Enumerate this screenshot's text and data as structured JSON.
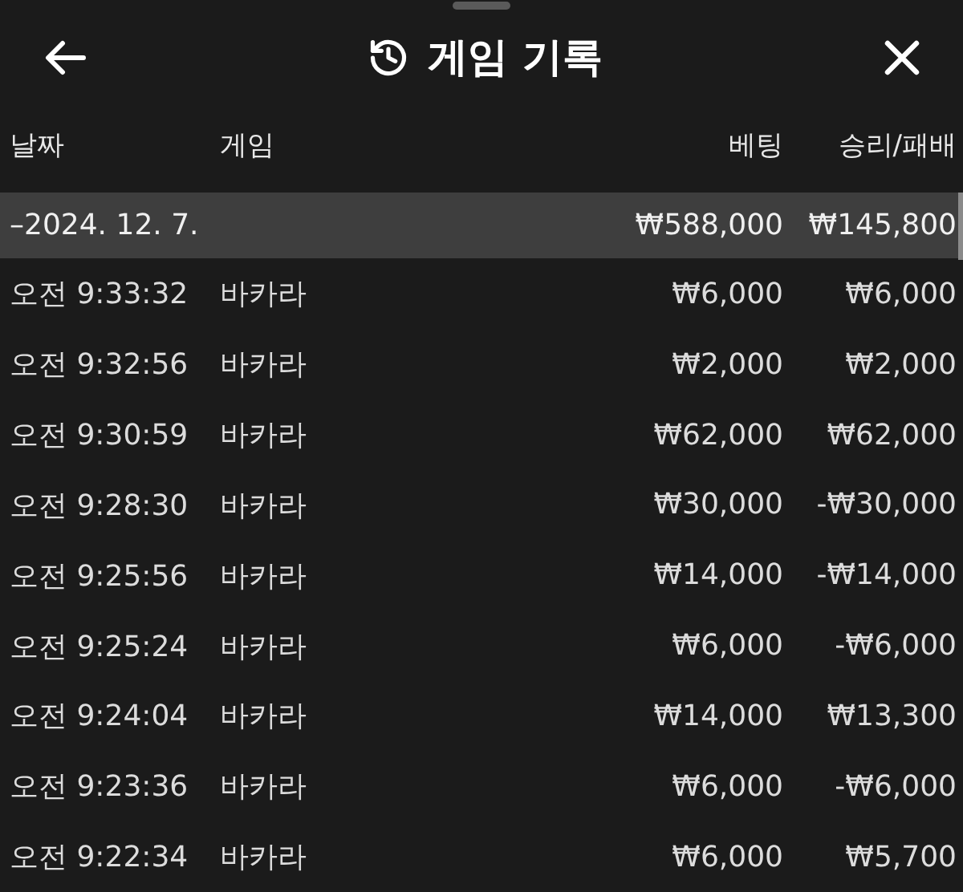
{
  "header": {
    "title": "게임 기록"
  },
  "columns": [
    "날짜",
    "게임",
    "베팅",
    "승리/패배"
  ],
  "group": {
    "date": "–2024. 12. 7.",
    "bet": "₩588,000",
    "result": "₩145,800"
  },
  "rows": [
    {
      "time": "오전 9:33:32",
      "game": "바카라",
      "bet": "₩6,000",
      "result": "₩6,000"
    },
    {
      "time": "오전 9:32:56",
      "game": "바카라",
      "bet": "₩2,000",
      "result": "₩2,000"
    },
    {
      "time": "오전 9:30:59",
      "game": "바카라",
      "bet": "₩62,000",
      "result": "₩62,000"
    },
    {
      "time": "오전 9:28:30",
      "game": "바카라",
      "bet": "₩30,000",
      "result": "-₩30,000"
    },
    {
      "time": "오전 9:25:56",
      "game": "바카라",
      "bet": "₩14,000",
      "result": "-₩14,000"
    },
    {
      "time": "오전 9:25:24",
      "game": "바카라",
      "bet": "₩6,000",
      "result": "-₩6,000"
    },
    {
      "time": "오전 9:24:04",
      "game": "바카라",
      "bet": "₩14,000",
      "result": "₩13,300"
    },
    {
      "time": "오전 9:23:36",
      "game": "바카라",
      "bet": "₩6,000",
      "result": "-₩6,000"
    },
    {
      "time": "오전 9:22:34",
      "game": "바카라",
      "bet": "₩6,000",
      "result": "₩5,700"
    }
  ]
}
